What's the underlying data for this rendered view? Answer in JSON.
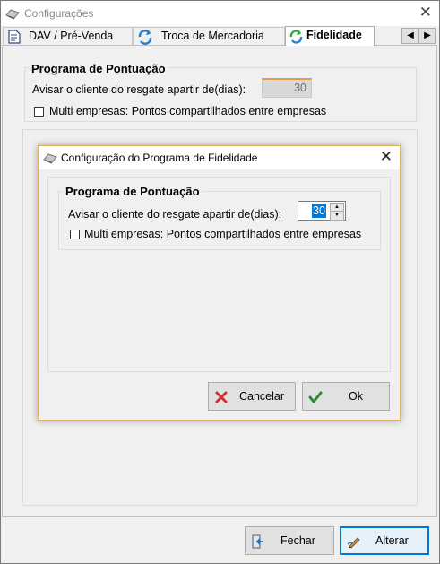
{
  "window": {
    "title": "Configurações"
  },
  "tabs": [
    {
      "label": "DAV / Pré-Venda"
    },
    {
      "label": "Troca de Mercadoria"
    },
    {
      "label": "Fidelidade"
    }
  ],
  "main": {
    "group_title": "Programa de Pontuação",
    "days_label": "Avisar o cliente do resgate apartir de(dias):",
    "days_value": "30",
    "multi_label": "Multi empresas: Pontos compartilhados entre empresas"
  },
  "dialog": {
    "title": "Configuração do Programa de Fidelidade",
    "group_title": "Programa de Pontuação",
    "days_label": "Avisar o cliente do resgate apartir de(dias):",
    "days_value": "30",
    "multi_label": "Multi empresas: Pontos compartilhados entre empresas",
    "cancel_label": "Cancelar",
    "ok_label": "Ok"
  },
  "footer": {
    "close_label": "Fechar",
    "alter_label": "Alterar"
  },
  "colors": {
    "selection": "#0078d7",
    "focus_border": "#0078d7",
    "cancel_x": "#d32f2f",
    "ok_check": "#2e8b2e"
  }
}
